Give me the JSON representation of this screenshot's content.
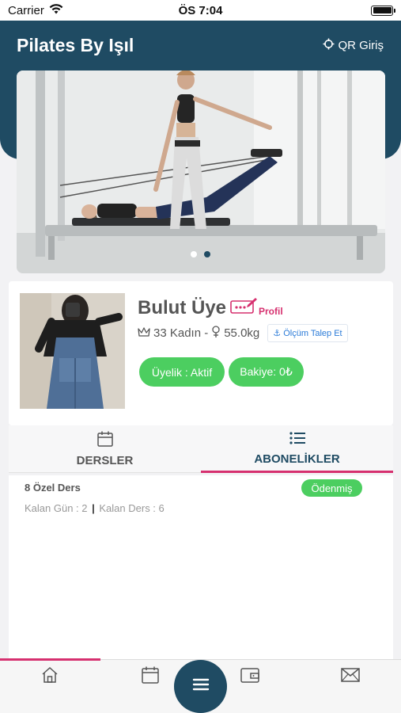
{
  "status_bar": {
    "carrier": "Carrier",
    "time": "ÖS 7:04"
  },
  "header": {
    "title": "Pilates By Işıl",
    "qr_label": "QR Giriş"
  },
  "carousel": {
    "slide_count": 2,
    "active_index": 1
  },
  "profile": {
    "name": "Bulut Üye",
    "profile_link": "Profil",
    "age_gender": "33 Kadın -",
    "weight": "55.0kg",
    "measure_button": "Ölçüm Talep Et",
    "membership_status": "Üyelik : Aktif",
    "balance": "Bakiye: 0₺"
  },
  "tabs": [
    {
      "label": "DERSLER",
      "icon": "calendar-icon",
      "active": false
    },
    {
      "label": "ABONELİKLER",
      "icon": "list-icon",
      "active": true
    }
  ],
  "subscription": {
    "title": "8 Özel Ders",
    "status": "Ödenmiş",
    "remaining_days": "Kalan Gün : 2",
    "separator": "|",
    "remaining_lessons": "Kalan Ders : 6"
  },
  "bottom_nav": [
    "home-icon",
    "calendar-icon",
    "menu-icon",
    "wallet-icon",
    "mail-icon"
  ],
  "colors": {
    "primary": "#1f4b63",
    "accent": "#d6306f",
    "success": "#4cce60",
    "link": "#2b7bd8"
  }
}
